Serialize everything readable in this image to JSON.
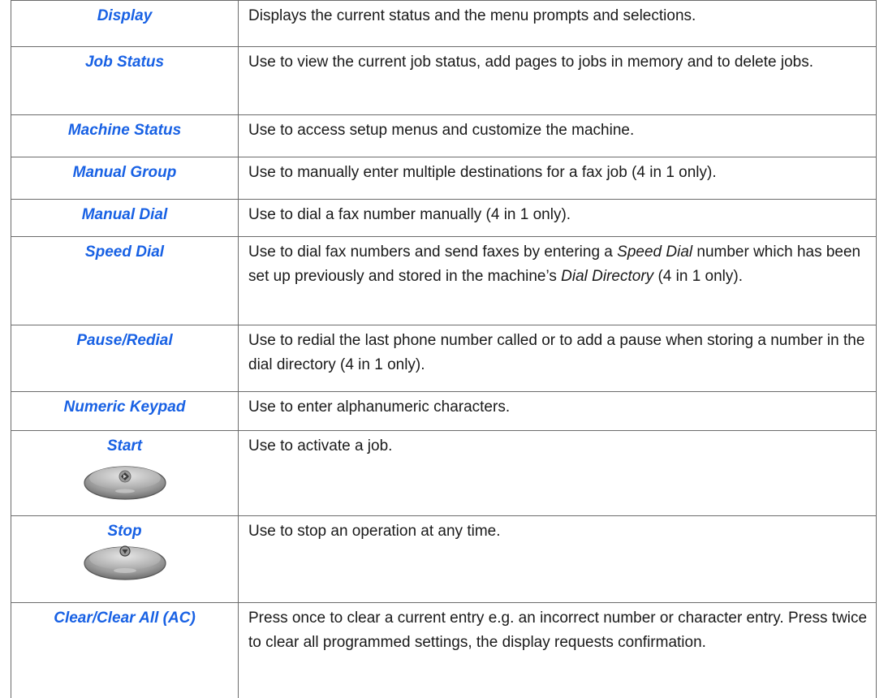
{
  "rows": [
    {
      "key": "Display",
      "desc": "Displays the current status and the menu prompts and selections."
    },
    {
      "key": "Job Status",
      "desc": "Use to view the current job status, add pages to jobs in memory and to delete jobs."
    },
    {
      "key": "Machine Status",
      "desc": "Use to access setup menus and customize the machine."
    },
    {
      "key": "Manual Group",
      "desc": "Use to manually enter multiple destinations for a fax job (4 in 1 only)."
    },
    {
      "key": "Manual Dial",
      "desc": "Use to dial a fax number manually (4 in 1 only)."
    },
    {
      "key": "Speed Dial",
      "desc_parts": {
        "p1": "Use to dial fax numbers and send faxes by entering a ",
        "em1": "Speed Dial",
        "p2": " number which has been set up previously and stored in the machine’s ",
        "em2": "Dial Directory",
        "p3": " (4 in 1 only)."
      }
    },
    {
      "key": "Pause/Redial",
      "desc": "Use to redial the last phone number called or to add a pause when storing a number in the dial directory (4 in 1 only)."
    },
    {
      "key": "Numeric Keypad",
      "desc": "Use to enter alphanumeric characters."
    },
    {
      "key": "Start",
      "desc": "Use to activate a job.",
      "icon": "start-button-icon"
    },
    {
      "key": "Stop",
      "desc": "Use to stop an operation at any time.",
      "icon": "stop-button-icon"
    },
    {
      "key": "Clear/Clear All (AC)",
      "desc": "Press once to clear a current entry e.g. an incorrect number or character entry. Press twice to clear all programmed settings, the display requests confirmation."
    }
  ],
  "colors": {
    "key_text": "#1861e4",
    "border": "#6b6b6b",
    "body_text": "#1a1a1a"
  }
}
